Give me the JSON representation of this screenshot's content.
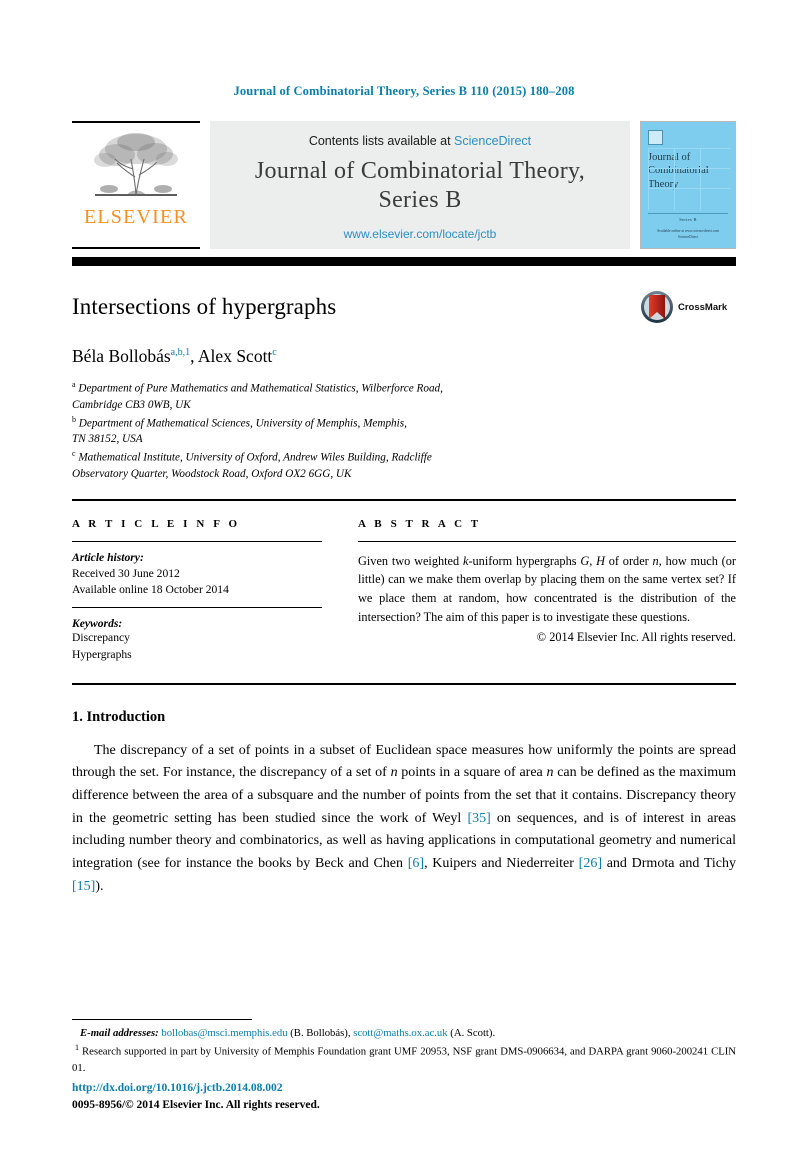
{
  "running_head": "Journal of Combinatorial Theory, Series B 110 (2015) 180–208",
  "masthead": {
    "contents_prefix": "Contents lists available at ",
    "sciencedirect": "ScienceDirect",
    "journal_title_line1": "Journal of Combinatorial Theory,",
    "journal_title_line2": "Series B",
    "journal_url": "www.elsevier.com/locate/jctb",
    "publisher_wordmark": "ELSEVIER",
    "cover": {
      "title_line1": "Journal of",
      "title_line2": "Combinatorial",
      "title_line3": "Theory",
      "series_label": "Series B",
      "footer_line1": "Available online at www.sciencedirect.com",
      "footer_line2": "ScienceDirect"
    }
  },
  "article": {
    "title": "Intersections of hypergraphs",
    "authors_name1": "Béla Bollobás",
    "authors_sup1": "a,b,1",
    "authors_separator": ", ",
    "authors_name2": "Alex Scott",
    "authors_sup2": "c",
    "crossmark_label": "CrossMark",
    "affiliations": [
      {
        "marker": "a",
        "line1": "Department of Pure Mathematics and Mathematical Statistics, Wilberforce Road,",
        "line2": "Cambridge CB3 0WB, UK"
      },
      {
        "marker": "b",
        "line1": "Department of Mathematical Sciences, University of Memphis, Memphis,",
        "line2": "TN 38152, USA"
      },
      {
        "marker": "c",
        "line1": "Mathematical Institute, University of Oxford, Andrew Wiles Building, Radcliffe",
        "line2": "Observatory Quarter, Woodstock Road, Oxford OX2 6GG, UK"
      }
    ]
  },
  "article_info": {
    "heading": "A R T I C L E    I N F O",
    "history_label": "Article history:",
    "received": "Received 30 June 2012",
    "available_online": "Available online 18 October 2014",
    "keywords_label": "Keywords:",
    "keywords": [
      "Discrepancy",
      "Hypergraphs"
    ]
  },
  "abstract": {
    "heading": "A B S T R A C T",
    "text_part1": "Given two weighted ",
    "math_k": "k",
    "text_part2": "-uniform hypergraphs ",
    "math_G": "G",
    "text_part3": ", ",
    "math_H": "H",
    "text_part4": " of order ",
    "math_n": "n",
    "text_part5": ", how much (or little) can we make them overlap by placing them on the same vertex set? If we place them at random, how concentrated is the distribution of the intersection? The aim of this paper is to investigate these questions.",
    "copyright": "© 2014 Elsevier Inc. All rights reserved."
  },
  "body": {
    "section_number_title": "1.  Introduction",
    "paragraph_1": {
      "s1": "The discrepancy of a set of points in a subset of Euclidean space measures how uniformly the points are spread through the set. For instance, the discrepancy of a set of ",
      "n1": "n",
      "s2": " points in a square of area ",
      "n2": "n",
      "s3": " can be defined as the maximum difference between the area of a subsquare and the number of points from the set that it contains. Discrepancy theory in the geometric setting has been studied since the work of Weyl ",
      "r1": "[35]",
      "s4": " on sequences, and is of interest in areas including number theory and combinatorics, as well as having applications in computational geometry and numerical integration (see for instance the books by Beck and Chen ",
      "r2": "[6]",
      "s5": ", Kuipers and Niederreiter ",
      "r3": "[26]",
      "s6": " and Drmota and Tichy ",
      "r4": "[15]",
      "s7": ")."
    }
  },
  "footnotes": {
    "email_label": "E-mail addresses:",
    "email1": "bollobas@msci.memphis.edu",
    "email1_owner": " (B. Bollobás), ",
    "email2": "scott@maths.ox.ac.uk",
    "email2_owner": " (A. Scott).",
    "grant_marker": "1",
    "grant_text": "Research supported in part by University of Memphis Foundation grant UMF 20953, NSF grant DMS-0906634, and DARPA grant 9060-200241 CLIN 01."
  },
  "colophon": {
    "doi": "http://dx.doi.org/10.1016/j.jctb.2014.08.002",
    "issn_line": "0095-8956/© 2014 Elsevier Inc. All rights reserved."
  },
  "colors": {
    "link_blue": "#0b7fab",
    "sciencedirect_blue": "#2b8fc4",
    "elsevier_orange": "#f7901e",
    "cover_blue": "#7fcdee",
    "masthead_grey": "#eceded"
  }
}
